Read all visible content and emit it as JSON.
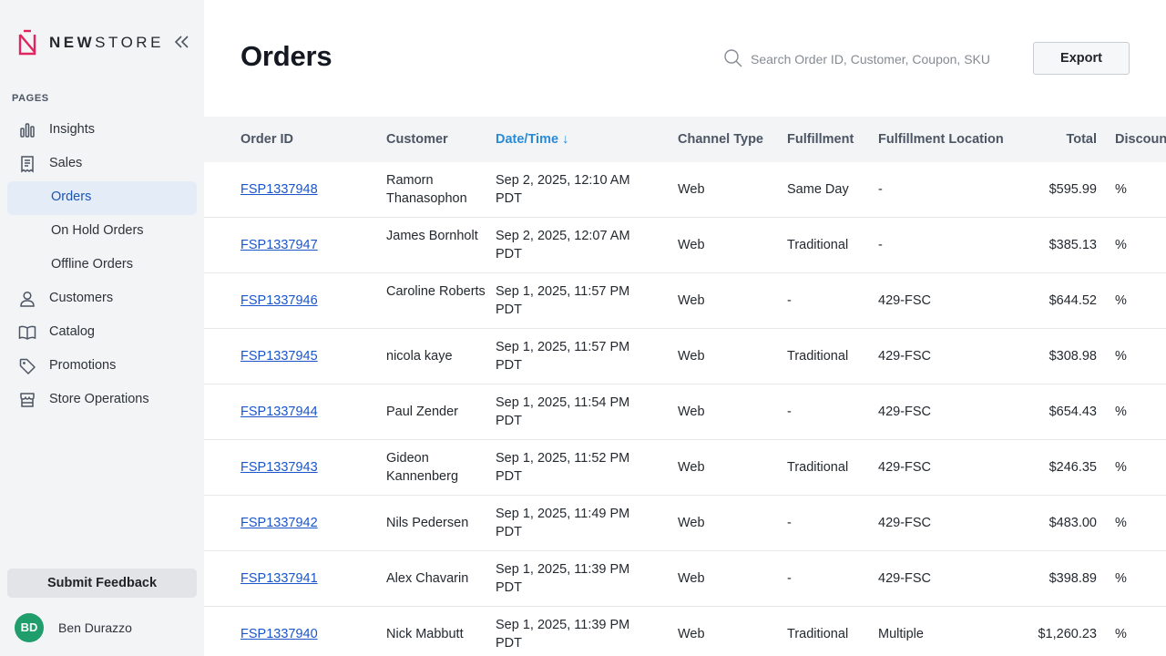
{
  "brand": {
    "name_bold": "NEW",
    "name_rest": "STORE"
  },
  "sidebar": {
    "section_label": "PAGES",
    "items": [
      {
        "label": "Insights",
        "icon": "bar-chart-icon"
      },
      {
        "label": "Sales",
        "icon": "receipt-icon"
      },
      {
        "label": "Orders",
        "sub": true,
        "active": true
      },
      {
        "label": "On Hold Orders",
        "sub": true
      },
      {
        "label": "Offline Orders",
        "sub": true
      },
      {
        "label": "Customers",
        "icon": "user-icon"
      },
      {
        "label": "Catalog",
        "icon": "book-icon"
      },
      {
        "label": "Promotions",
        "icon": "tag-icon"
      },
      {
        "label": "Store Operations",
        "icon": "store-icon"
      }
    ],
    "feedback_label": "Submit Feedback",
    "user": {
      "initials": "BD",
      "name": "Ben Durazzo"
    }
  },
  "header": {
    "title": "Orders",
    "search_placeholder": "Search Order ID, Customer, Coupon, SKU",
    "export_label": "Export"
  },
  "table": {
    "columns": {
      "order_id": "Order ID",
      "customer": "Customer",
      "datetime": "Date/Time ↓",
      "channel": "Channel Type",
      "fulfillment": "Fulfillment",
      "location": "Fulfillment Location",
      "total": "Total",
      "discount": "Discoun"
    },
    "rows": [
      {
        "order_id": "FSP1337948",
        "customer": "Ramorn Thanasophon",
        "date": "Sep 2, 2025, 12:10 AM PDT",
        "channel": "Web",
        "fulfillment": "Same Day",
        "location": "-",
        "total": "$595.99",
        "discount": "%"
      },
      {
        "order_id": "FSP1337947",
        "customer": "James Bornholt",
        "date": "Sep 2, 2025, 12:07 AM PDT",
        "channel": "Web",
        "fulfillment": "Traditional",
        "location": "-",
        "total": "$385.13",
        "discount": "%"
      },
      {
        "order_id": "FSP1337946",
        "customer": "Caroline Roberts",
        "date": "Sep 1, 2025, 11:57 PM PDT",
        "channel": "Web",
        "fulfillment": "-",
        "location": "429-FSC",
        "total": "$644.52",
        "discount": "%"
      },
      {
        "order_id": "FSP1337945",
        "customer": "nicola kaye",
        "date": "Sep 1, 2025, 11:57 PM PDT",
        "channel": "Web",
        "fulfillment": "Traditional",
        "location": "429-FSC",
        "total": "$308.98",
        "discount": "%"
      },
      {
        "order_id": "FSP1337944",
        "customer": "Paul Zender",
        "date": "Sep 1, 2025, 11:54 PM PDT",
        "channel": "Web",
        "fulfillment": "-",
        "location": "429-FSC",
        "total": "$654.43",
        "discount": "%"
      },
      {
        "order_id": "FSP1337943",
        "customer": "Gideon Kannenberg",
        "date": "Sep 1, 2025, 11:52 PM PDT",
        "channel": "Web",
        "fulfillment": "Traditional",
        "location": "429-FSC",
        "total": "$246.35",
        "discount": "%"
      },
      {
        "order_id": "FSP1337942",
        "customer": "Nils Pedersen",
        "date": "Sep 1, 2025, 11:49 PM PDT",
        "channel": "Web",
        "fulfillment": "-",
        "location": "429-FSC",
        "total": "$483.00",
        "discount": "%"
      },
      {
        "order_id": "FSP1337941",
        "customer": "Alex Chavarin",
        "date": "Sep 1, 2025, 11:39 PM PDT",
        "channel": "Web",
        "fulfillment": "-",
        "location": "429-FSC",
        "total": "$398.89",
        "discount": "%"
      },
      {
        "order_id": "FSP1337940",
        "customer": "Nick Mabbutt",
        "date": "Sep 1, 2025, 11:39 PM PDT",
        "channel": "Web",
        "fulfillment": "Traditional",
        "location": "Multiple",
        "total": "$1,260.23",
        "discount": "%"
      }
    ]
  },
  "colors": {
    "accent": "#2a8bd6",
    "link": "#1c55c9",
    "brand": "#e0245e",
    "avatar": "#1f9d6a",
    "active_bg": "#e4ecf8"
  }
}
